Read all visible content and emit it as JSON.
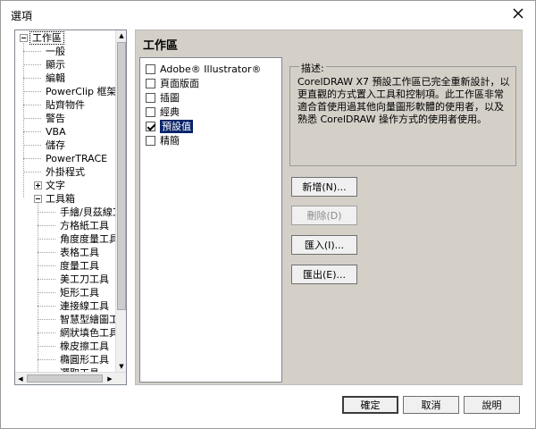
{
  "window": {
    "title": "選項",
    "close_icon": "close-icon"
  },
  "tree": {
    "items": [
      {
        "label": "工作區",
        "level": 0,
        "expander": "minus",
        "selected": true
      },
      {
        "label": "一般",
        "level": 1
      },
      {
        "label": "顯示",
        "level": 1
      },
      {
        "label": "編輯",
        "level": 1
      },
      {
        "label": "PowerClip 框架",
        "level": 1
      },
      {
        "label": "貼齊物件",
        "level": 1
      },
      {
        "label": "警告",
        "level": 1
      },
      {
        "label": "VBA",
        "level": 1
      },
      {
        "label": "儲存",
        "level": 1
      },
      {
        "label": "PowerTRACE",
        "level": 1
      },
      {
        "label": "外掛程式",
        "level": 1
      },
      {
        "label": "文字",
        "level": 1,
        "expander": "plus"
      },
      {
        "label": "工具箱",
        "level": 1,
        "expander": "minus"
      },
      {
        "label": "手繪/貝茲線工",
        "level": 2
      },
      {
        "label": "方格紙工具",
        "level": 2
      },
      {
        "label": "角度度量工具",
        "level": 2
      },
      {
        "label": "表格工具",
        "level": 2
      },
      {
        "label": "度量工具",
        "level": 2
      },
      {
        "label": "美工刀工具",
        "level": 2
      },
      {
        "label": "矩形工具",
        "level": 2
      },
      {
        "label": "連接線工具",
        "level": 2
      },
      {
        "label": "智慧型繪圖工",
        "level": 2
      },
      {
        "label": "網狀填色工具",
        "level": 2
      },
      {
        "label": "橡皮擦工具",
        "level": 2
      },
      {
        "label": "橢圓形工具",
        "level": 2
      },
      {
        "label": "選取工具",
        "level": 2
      }
    ]
  },
  "main": {
    "title": "工作區",
    "workspaces": [
      {
        "label": "Adobe® Illustrator®",
        "checked": false
      },
      {
        "label": "頁面版面",
        "checked": false
      },
      {
        "label": "插圖",
        "checked": false
      },
      {
        "label": "經典",
        "checked": false
      },
      {
        "label": "預設值",
        "checked": true,
        "selected": true
      },
      {
        "label": "精簡",
        "checked": false
      }
    ],
    "description_label": "描述:",
    "description_text": "CorelDRAW X7 預設工作區已完全重新設計，以更直觀的方式置入工具和控制項。此工作區非常適合首使用過其他向量圖形軟體的使用者，以及熟悉 CorelDRAW 操作方式的使用者使用。",
    "buttons": {
      "new": "新增(N)...",
      "delete": "刪除(D)",
      "import": "匯入(I)...",
      "export": "匯出(E)..."
    }
  },
  "footer": {
    "ok": "確定",
    "cancel": "取消",
    "help": "說明"
  }
}
